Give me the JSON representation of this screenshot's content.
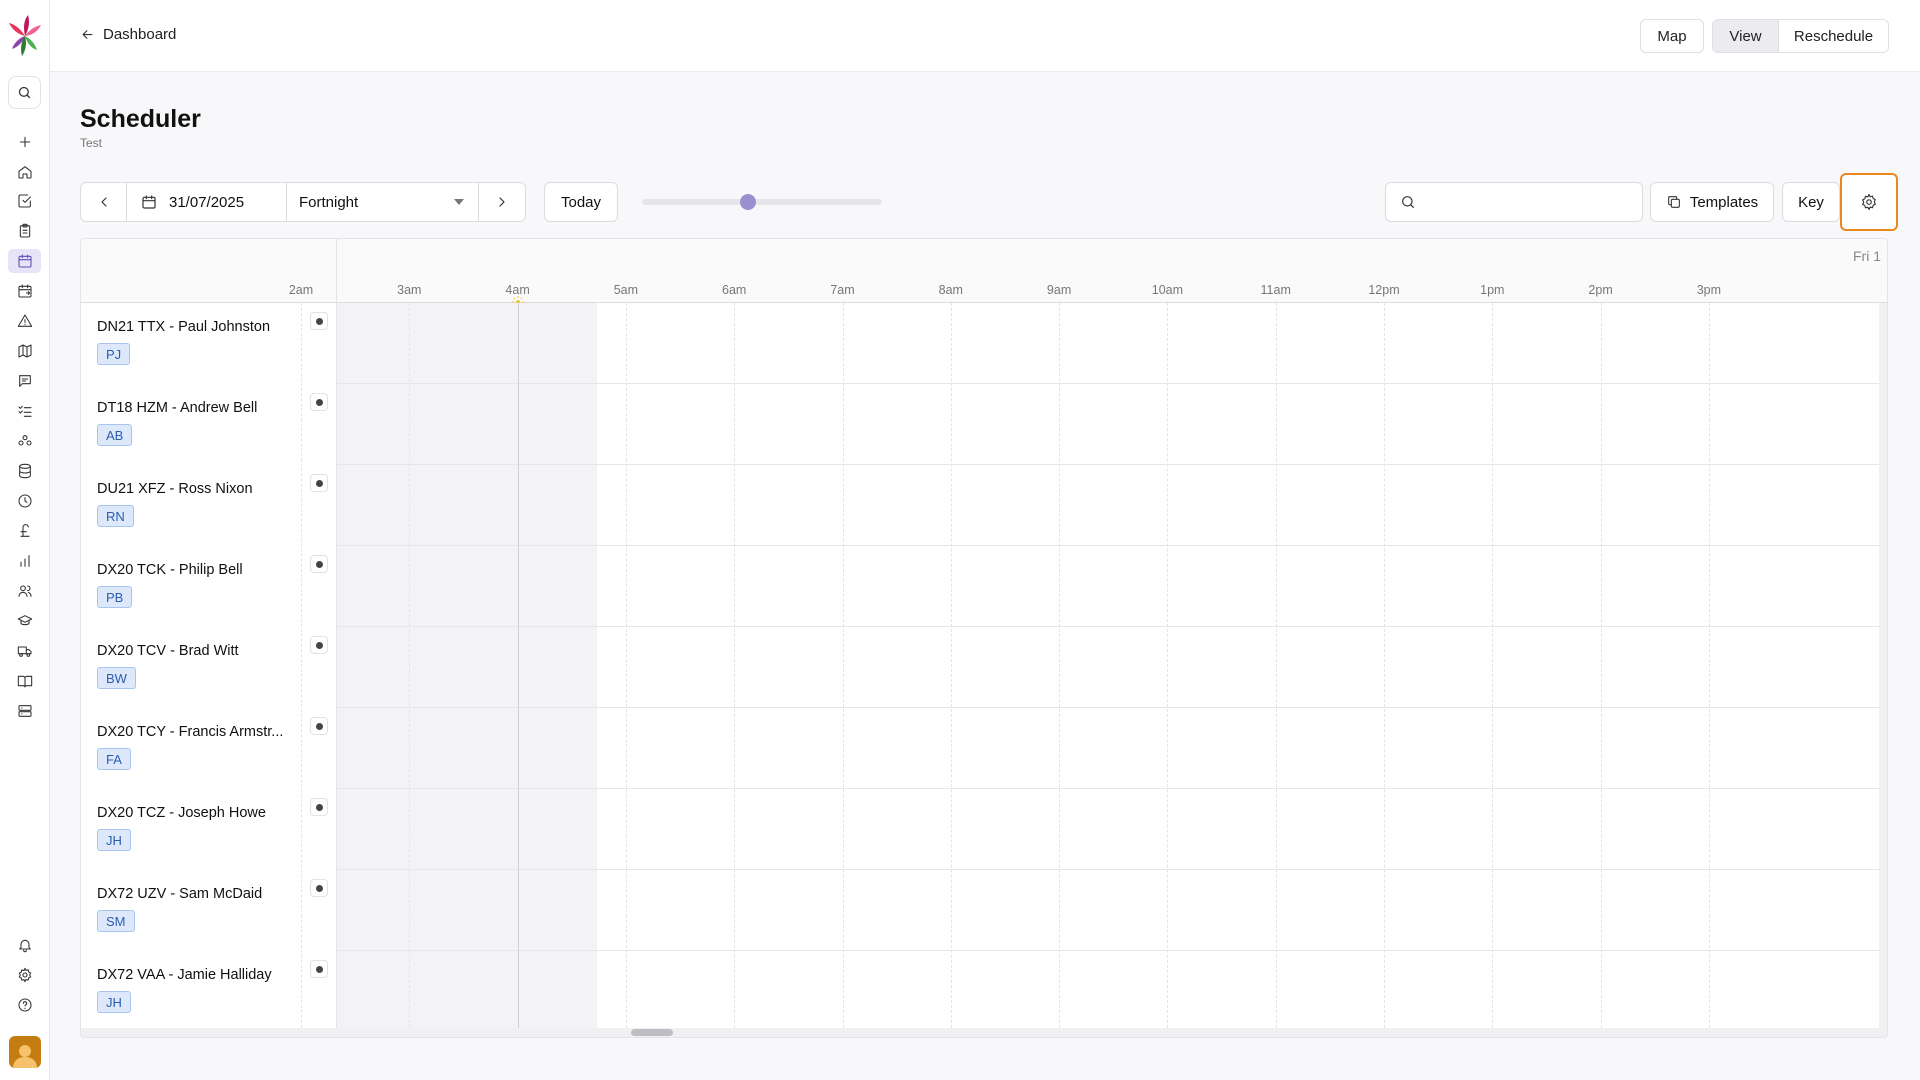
{
  "sidebar": {
    "icons": [
      "search-icon",
      "plus-icon",
      "home-icon",
      "check-square-icon",
      "clipboard-icon",
      "calendar-icon",
      "calendar-refresh-icon",
      "alert-triangle-icon",
      "map-icon",
      "message-icon",
      "list-check-icon",
      "users-group-icon",
      "database-icon",
      "clock-icon",
      "pound-icon",
      "bar-chart-icon",
      "people-icon",
      "graduation-cap-icon",
      "truck-icon",
      "book-icon",
      "server-icon",
      "bell-icon",
      "gear-icon",
      "help-circle-icon"
    ],
    "active_item": "calendar-icon"
  },
  "header": {
    "back_label": "Dashboard",
    "map_label": "Map",
    "view_label": "View",
    "reschedule_label": "Reschedule"
  },
  "page": {
    "title": "Scheduler",
    "subtitle": "Test"
  },
  "toolbar": {
    "date_value": "31/07/2025",
    "range_value": "Fortnight",
    "today_label": "Today",
    "zoom_level": 0.44,
    "search_placeholder": "",
    "templates_label": "Templates",
    "key_label": "Key"
  },
  "timeline": {
    "day_label": "Fri 1",
    "hours": [
      "2am",
      "3am",
      "4am",
      "5am",
      "6am",
      "7am",
      "8am",
      "9am",
      "10am",
      "11am",
      "12pm",
      "1pm",
      "2pm",
      "3pm"
    ],
    "current_time_hour": "4am"
  },
  "resources": [
    {
      "name": "DN21 TTX - Paul Johnston",
      "initials": "PJ"
    },
    {
      "name": "DT18 HZM - Andrew Bell",
      "initials": "AB"
    },
    {
      "name": "DU21 XFZ - Ross Nixon",
      "initials": "RN"
    },
    {
      "name": "DX20 TCK - Philip Bell",
      "initials": "PB"
    },
    {
      "name": "DX20 TCV - Brad Witt",
      "initials": "BW"
    },
    {
      "name": "DX20 TCY - Francis Armstr...",
      "initials": "FA"
    },
    {
      "name": "DX20 TCZ - Joseph Howe",
      "initials": "JH"
    },
    {
      "name": "DX72 UZV - Sam McDaid",
      "initials": "SM"
    },
    {
      "name": "DX72 VAA - Jamie Halliday",
      "initials": "JH"
    }
  ],
  "colors": {
    "accent": "#9b8fd2",
    "focus_ring": "#e8891c",
    "badge_bg": "#dde9fb",
    "badge_text": "#2a5db0"
  }
}
